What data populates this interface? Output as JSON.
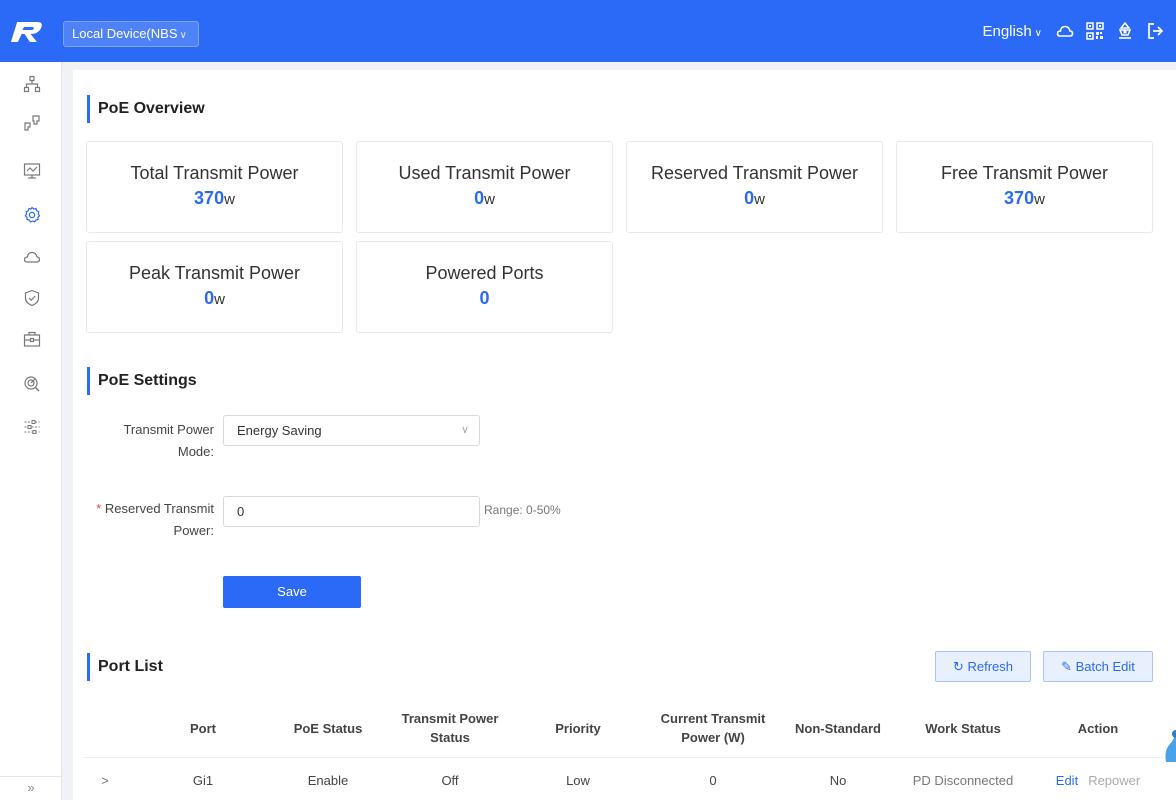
{
  "header": {
    "device": "Local Device(NBS",
    "language": "English"
  },
  "sidebar": {
    "items": [
      {
        "icon": "network-topology-icon"
      },
      {
        "icon": "switch-ports-icon"
      },
      {
        "icon": "monitor-icon"
      },
      {
        "icon": "gear-icon"
      },
      {
        "icon": "cloud-icon"
      },
      {
        "icon": "shield-icon"
      },
      {
        "icon": "toolbox-icon"
      },
      {
        "icon": "diagnostics-icon"
      },
      {
        "icon": "sliders-icon"
      }
    ],
    "collapse": "»"
  },
  "overview": {
    "title": "PoE Overview",
    "cards": [
      {
        "label": "Total Transmit Power",
        "value": "370",
        "unit": "w"
      },
      {
        "label": "Used Transmit Power",
        "value": "0",
        "unit": "w"
      },
      {
        "label": "Reserved Transmit Power",
        "value": "0",
        "unit": "w"
      },
      {
        "label": "Free Transmit Power",
        "value": "370",
        "unit": "w"
      },
      {
        "label": "Peak Transmit Power",
        "value": "0",
        "unit": "w"
      },
      {
        "label": "Powered Ports",
        "value": "0",
        "unit": ""
      }
    ]
  },
  "settings": {
    "title": "PoE Settings",
    "mode_label_1": "Transmit Power",
    "mode_label_2": "Mode:",
    "mode_value": "Energy Saving",
    "reserved_required": "*",
    "reserved_label_1": "Reserved Transmit",
    "reserved_label_2": "Power:",
    "reserved_value": "0",
    "range_hint": "Range: 0-50%",
    "save_label": "Save"
  },
  "ports": {
    "title": "Port List",
    "refresh_label": "Refresh",
    "batch_edit_label": "Batch Edit",
    "columns": [
      "Port",
      "PoE Status",
      "Transmit Power Status",
      "Priority",
      "Current Transmit Power (W)",
      "Non-Standard",
      "Work Status",
      "Action"
    ],
    "rows": [
      {
        "expand": ">",
        "port": "Gi1",
        "poe_status": "Enable",
        "tx_status": "Off",
        "priority": "Low",
        "current_power": "0",
        "non_standard": "No",
        "work_status": "PD Disconnected",
        "edit": "Edit",
        "repower": "Repower"
      }
    ]
  },
  "colors": {
    "accent": "#2b6af7",
    "topbar": "#2b6af7"
  }
}
